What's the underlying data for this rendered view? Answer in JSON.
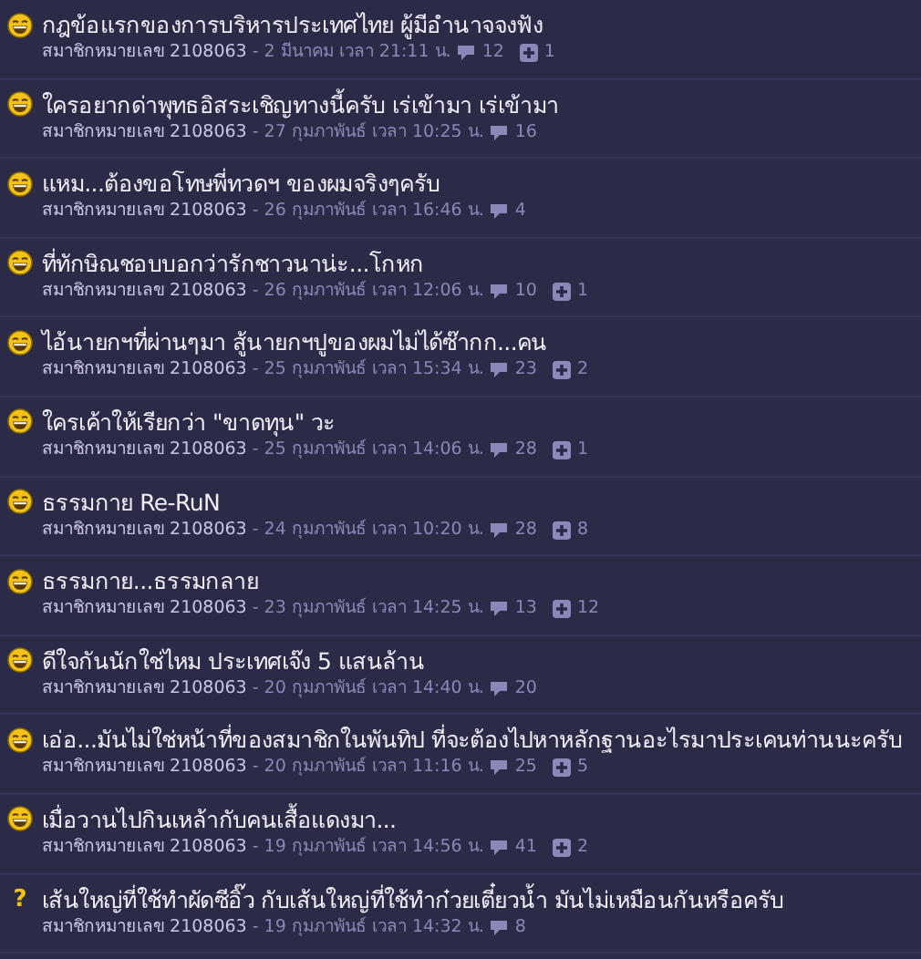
{
  "topics": [
    {
      "kind": "laugh",
      "title": "กฎข้อแรกของการบริหารประเทศไทย ผู้มีอำนาจจงฟัง",
      "author": "สมาชิกหมายเลข 2108063",
      "date": "- 2 มีนาคม เวลา 21:11 น.",
      "comments": "12",
      "votes": "1"
    },
    {
      "kind": "laugh",
      "title": "ใครอยากด่าพุทธอิสระเชิญทางนี้ครับ เร่เข้ามา เร่เข้ามา",
      "author": "สมาชิกหมายเลข 2108063",
      "date": "- 27 กุมภาพันธ์ เวลา 10:25 น.",
      "comments": "16"
    },
    {
      "kind": "laugh",
      "title": "แหม...ต้องขอโทษพี่ทวดฯ ของผมจริงๆครับ",
      "author": "สมาชิกหมายเลข 2108063",
      "date": "- 26 กุมภาพันธ์ เวลา 16:46 น.",
      "comments": "4"
    },
    {
      "kind": "laugh",
      "title": "ที่ทักษิณชอบบอกว่ารักชาวนาน่ะ...โกหก",
      "author": "สมาชิกหมายเลข 2108063",
      "date": "- 26 กุมภาพันธ์ เวลา 12:06 น.",
      "comments": "10",
      "votes": "1"
    },
    {
      "kind": "laugh",
      "title": "ไอ้นายกฯที่ผ่านๆมา สู้นายกฯปูของผมไม่ได้ซ๊ากก...คน",
      "author": "สมาชิกหมายเลข 2108063",
      "date": "- 25 กุมภาพันธ์ เวลา 15:34 น.",
      "comments": "23",
      "votes": "2"
    },
    {
      "kind": "laugh",
      "title": "ใครเค้าให้เรียกว่า \"ขาดทุน\" วะ",
      "author": "สมาชิกหมายเลข 2108063",
      "date": "- 25 กุมภาพันธ์ เวลา 14:06 น.",
      "comments": "28",
      "votes": "1"
    },
    {
      "kind": "laugh",
      "title": "ธรรมกาย Re-RuN",
      "author": "สมาชิกหมายเลข 2108063",
      "date": "- 24 กุมภาพันธ์ เวลา 10:20 น.",
      "comments": "28",
      "votes": "8"
    },
    {
      "kind": "laugh",
      "title": "ธรรมกาย...ธรรมกลาย",
      "author": "สมาชิกหมายเลข 2108063",
      "date": "- 23 กุมภาพันธ์ เวลา 14:25 น.",
      "comments": "13",
      "votes": "12"
    },
    {
      "kind": "laugh",
      "title": "ดีใจกันนักใช่ไหม ประเทศเจ๊ง 5 แสนล้าน",
      "author": "สมาชิกหมายเลข 2108063",
      "date": "- 20 กุมภาพันธ์ เวลา 14:40 น.",
      "comments": "20"
    },
    {
      "kind": "laugh",
      "title": "เอ่อ...มันไม่ใช่หน้าที่ของสมาชิกในพันทิป ที่จะต้องไปหาหลักฐานอะไรมาประเคนท่านนะครับ",
      "author": "สมาชิกหมายเลข 2108063",
      "date": "- 20 กุมภาพันธ์ เวลา 11:16 น.",
      "comments": "25",
      "votes": "5"
    },
    {
      "kind": "laugh",
      "title": "เมื่อวานไปกินเหล้ากับคนเสื้อแดงมา...",
      "author": "สมาชิกหมายเลข 2108063",
      "date": "- 19 กุมภาพันธ์ เวลา 14:56 น.",
      "comments": "41",
      "votes": "2"
    },
    {
      "kind": "question",
      "mark": "?",
      "title": "เส้นใหญ่ที่ใช้ทำผัดซีอิ๊ว กับเส้นใหญ่ที่ใช้ทำก๋วยเตี๋ยวน้ำ มันไม่เหมือนกันหรือครับ",
      "author": "สมาชิกหมายเลข 2108063",
      "date": "- 19 กุมภาพันธ์ เวลา 14:32 น.",
      "comments": "8"
    }
  ]
}
